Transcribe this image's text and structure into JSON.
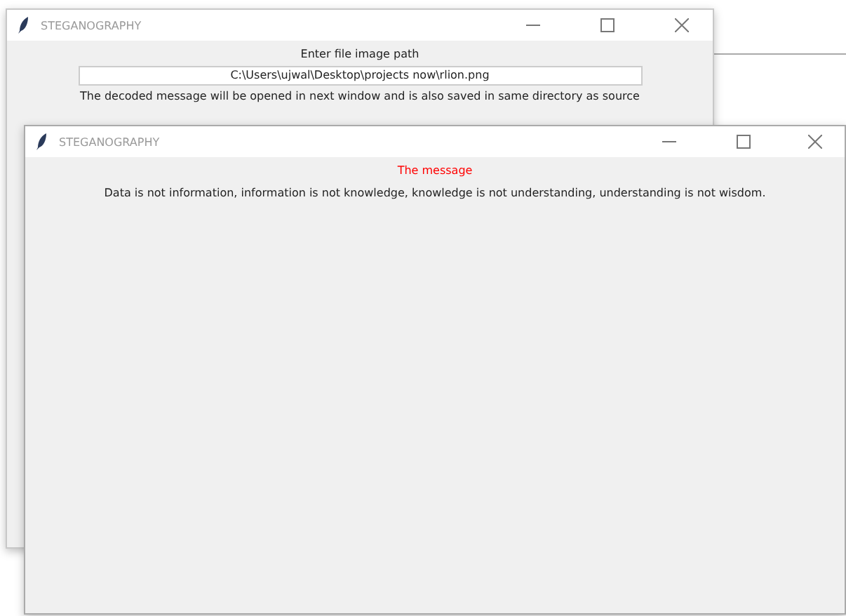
{
  "windows": [
    {
      "title": "STEGANOGRAPHY",
      "lines": [
        {
          "kind": "label",
          "text": "Enter file image path"
        },
        {
          "kind": "entry",
          "text": "C:\\Users\\ujwal\\Desktop\\projects now\\rlion.png"
        },
        {
          "kind": "label",
          "text": "The decoded message will be opened in next window and is also saved in same directory as source"
        }
      ]
    },
    {
      "title": "STEGANOGRAPHY",
      "lines": [
        {
          "kind": "heading",
          "text": "The message",
          "color": "#ff0000"
        },
        {
          "kind": "label",
          "text": "Data is not information, information is not knowledge, knowledge is not understanding, understanding is not wisdom."
        }
      ]
    }
  ]
}
